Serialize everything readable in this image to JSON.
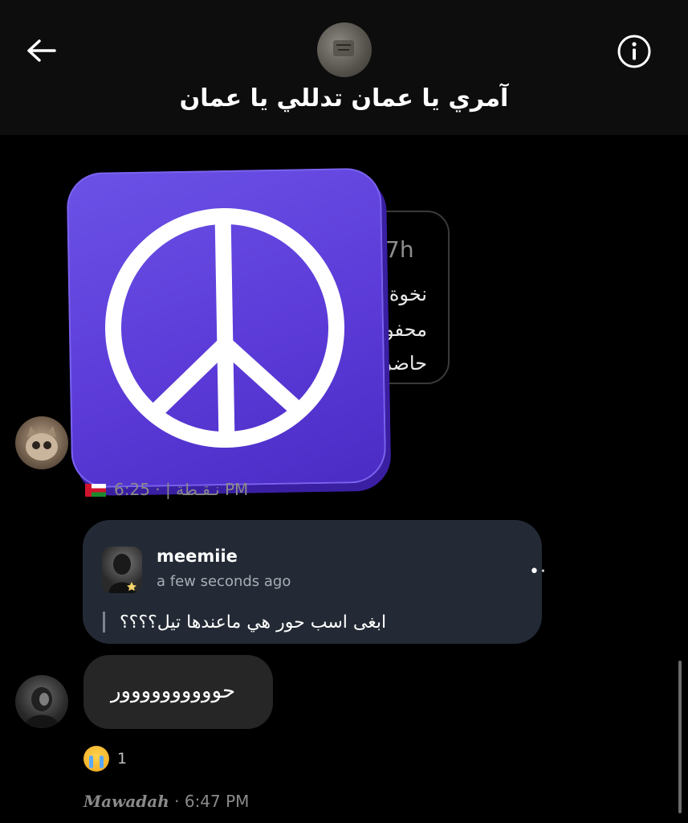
{
  "header": {
    "title": "آمري يا عمان تدللي يا عمان"
  },
  "shared_post": {
    "time": "7h",
    "lines": [
      "نخوة",
      "محفو",
      "حاضر"
    ]
  },
  "messages": [
    {
      "sender_signature": "نـقـطة |",
      "time": "· 6:25 PM"
    },
    {
      "reply_to": {
        "username": "meemiie",
        "time": "a few seconds ago",
        "text": "ابغى اسب حور هي ماعندها تيل؟؟؟؟"
      }
    },
    {
      "text": "حوووووووووور",
      "reaction": {
        "emoji": "😭",
        "count": "1"
      },
      "sender_signature": "Mawadah",
      "time": "· 6:47 PM"
    }
  ],
  "colors": {
    "sticker": "#5c3bd8",
    "reply_bubble": "#232a35",
    "message_bubble": "#262626",
    "background": "#000000"
  },
  "icons": {
    "back": "arrow-left-icon",
    "info": "info-icon",
    "more": "more-dots-icon",
    "sticker": "peace-sign-icon"
  }
}
